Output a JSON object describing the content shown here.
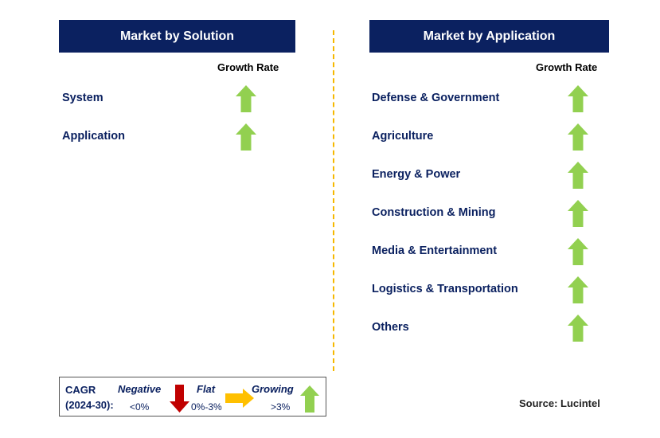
{
  "left": {
    "title": "Market by Solution",
    "growth_label": "Growth Rate",
    "items": [
      {
        "label": "System",
        "trend": "growing"
      },
      {
        "label": "Application",
        "trend": "growing"
      }
    ]
  },
  "right": {
    "title": "Market by Application",
    "growth_label": "Growth Rate",
    "items": [
      {
        "label": "Defense & Government",
        "trend": "growing"
      },
      {
        "label": "Agriculture",
        "trend": "growing"
      },
      {
        "label": "Energy & Power",
        "trend": "growing"
      },
      {
        "label": "Construction & Mining",
        "trend": "growing"
      },
      {
        "label": "Media & Entertainment",
        "trend": "growing"
      },
      {
        "label": "Logistics & Transportation",
        "trend": "growing"
      },
      {
        "label": "Others",
        "trend": "growing"
      }
    ]
  },
  "legend": {
    "cagr": "CAGR",
    "period": "(2024-30):",
    "negative": "Negative",
    "negative_range": "<0%",
    "flat": "Flat",
    "flat_range": "0%-3%",
    "growing": "Growing",
    "growing_range": ">3%"
  },
  "source": "Source: Lucintel",
  "colors": {
    "header": "#0b2160",
    "growing": "#92d050",
    "flat": "#ffc000",
    "negative": "#c00000",
    "divider": "#f5b800"
  }
}
